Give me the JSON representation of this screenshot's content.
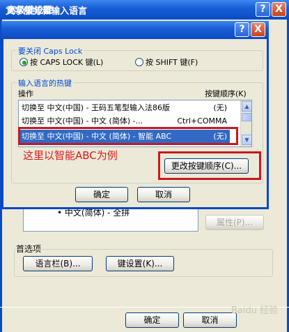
{
  "outer": {
    "title": "文字服务和输入语言",
    "help_btn": "?",
    "close_btn": "X",
    "list_item": "• 中文(简体) - 全拼",
    "properties_btn": "属性(P)...",
    "prefs_label": "首选项",
    "langbar_btn": "语言栏(B)...",
    "keyset_btn": "键设置(K)...",
    "ok_btn": "确定",
    "cancel_btn": "取消",
    "watermark": "Baidu 经验"
  },
  "dialog": {
    "title": "高级键设置",
    "help_btn": "?",
    "close_btn": "X",
    "capslock_group": "要关闭 Caps Lock",
    "radio_caps": "按 CAPS LOCK 键(L)",
    "radio_shift": "按 SHIFT 键(F)",
    "radio_caps_checked": true,
    "hotkey_group": "输入语言的热键",
    "col_action": "操作",
    "col_keys": "按键顺序(K)",
    "rows": [
      {
        "action": "切换至 中文(中国) - 王码五笔型输入法86版",
        "keys": "(无)",
        "selected": false
      },
      {
        "action": "切换至 中文(中国) - 中文 (简体) -...",
        "keys": "Ctrl+COMMA",
        "selected": false
      },
      {
        "action": "切换至 中文(中国) - 中文 (简体) - 智能 ABC",
        "keys": "(无)",
        "selected": true
      }
    ],
    "change_btn": "更改按键顺序(C)...",
    "ok_btn": "确定",
    "cancel_btn": "取消"
  },
  "annotation": "这里以智能ABC为例",
  "colors": {
    "title_blue": "#0a4bc4",
    "selection": "#316ac5",
    "annotation_red": "#c8191e"
  }
}
